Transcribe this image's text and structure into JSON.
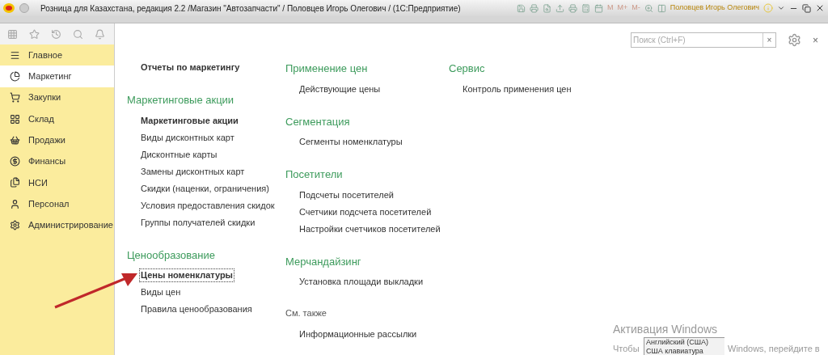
{
  "window": {
    "title": "Розница для Казахстана, редакция 2.2 /Магазин \"Автозапчасти\" / Половцев Игорь Олегович / (1С:Предприятие)",
    "toolbar_labels": [
      "M",
      "M+",
      "M-"
    ],
    "user": "Половцев Игорь Олегович"
  },
  "sidebar": {
    "items": [
      {
        "label": "Главное",
        "selected": false
      },
      {
        "label": "Маркетинг",
        "selected": true
      },
      {
        "label": "Закупки",
        "selected": false
      },
      {
        "label": "Склад",
        "selected": false
      },
      {
        "label": "Продажи",
        "selected": false
      },
      {
        "label": "Финансы",
        "selected": false
      },
      {
        "label": "НСИ",
        "selected": false
      },
      {
        "label": "Персонал",
        "selected": false
      },
      {
        "label": "Администрирование",
        "selected": false
      }
    ]
  },
  "search": {
    "placeholder": "Поиск (Ctrl+F)",
    "clear": "×"
  },
  "close": "×",
  "columns": [
    [
      {
        "kind": "plain",
        "items": [
          {
            "label": "Отчеты по маркетингу",
            "bold": true,
            "focused": false
          }
        ]
      },
      {
        "kind": "section",
        "title": "Маркетинговые акции",
        "items": [
          {
            "label": "Маркетинговые акции",
            "bold": true,
            "focused": false
          },
          {
            "label": "Виды дисконтных карт",
            "bold": false,
            "focused": false
          },
          {
            "label": "Дисконтные карты",
            "bold": false,
            "focused": false
          },
          {
            "label": "Замены дисконтных карт",
            "bold": false,
            "focused": false
          },
          {
            "label": "Скидки (наценки, ограничения)",
            "bold": false,
            "focused": false
          },
          {
            "label": "Условия предоставления скидок",
            "bold": false,
            "focused": false
          },
          {
            "label": "Группы получателей скидки",
            "bold": false,
            "focused": false
          }
        ]
      },
      {
        "kind": "section",
        "title": "Ценообразование",
        "items": [
          {
            "label": "Цены номенклатуры",
            "bold": true,
            "focused": true
          },
          {
            "label": "Виды цен",
            "bold": false,
            "focused": false
          },
          {
            "label": "Правила ценообразования",
            "bold": false,
            "focused": false
          }
        ]
      }
    ],
    [
      {
        "kind": "section",
        "title": "Применение цен",
        "items": [
          {
            "label": "Действующие цены",
            "bold": false,
            "focused": false
          }
        ]
      },
      {
        "kind": "section",
        "title": "Сегментация",
        "items": [
          {
            "label": "Сегменты номенклатуры",
            "bold": false,
            "focused": false
          }
        ]
      },
      {
        "kind": "section",
        "title": "Посетители",
        "items": [
          {
            "label": "Подсчеты посетителей",
            "bold": false,
            "focused": false
          },
          {
            "label": "Счетчики подсчета посетителей",
            "bold": false,
            "focused": false
          },
          {
            "label": "Настройки счетчиков посетителей",
            "bold": false,
            "focused": false
          }
        ]
      },
      {
        "kind": "section",
        "title": "Мерчандайзинг",
        "items": [
          {
            "label": "Установка площади выкладки",
            "bold": false,
            "focused": false
          }
        ]
      },
      {
        "kind": "see_also",
        "title": "См. также",
        "items": [
          {
            "label": "Информационные рассылки",
            "bold": false,
            "focused": false
          }
        ]
      }
    ],
    [
      {
        "kind": "section",
        "title": "Сервис",
        "items": [
          {
            "label": "Контроль применения цен",
            "bold": false,
            "focused": false
          }
        ]
      }
    ]
  ],
  "activation": {
    "title": "Активация Windows",
    "line_start": "Чтобы",
    "line_end": "Windows, перейдите в"
  },
  "keyboard_tooltip": [
    "Английский (США)",
    "США клавиатура"
  ]
}
